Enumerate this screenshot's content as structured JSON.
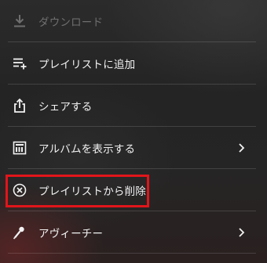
{
  "menu": {
    "items": [
      {
        "label": "ダウンロード",
        "icon": "download-icon",
        "disabled": true,
        "chevron": false
      },
      {
        "label": "プレイリストに追加",
        "icon": "add-to-playlist-icon",
        "disabled": false,
        "chevron": false
      },
      {
        "label": "シェアする",
        "icon": "share-icon",
        "disabled": false,
        "chevron": false
      },
      {
        "label": "アルバムを表示する",
        "icon": "album-icon",
        "disabled": false,
        "chevron": true
      },
      {
        "label": "プレイリストから削除",
        "icon": "remove-circle-icon",
        "disabled": false,
        "chevron": false
      },
      {
        "label": "アヴィーチー",
        "icon": "artist-mic-icon",
        "disabled": false,
        "chevron": true
      }
    ]
  },
  "colors": {
    "highlight_border": "#e1151a",
    "text": "#f2f2f2",
    "disabled_text": "#6e6e6e"
  }
}
